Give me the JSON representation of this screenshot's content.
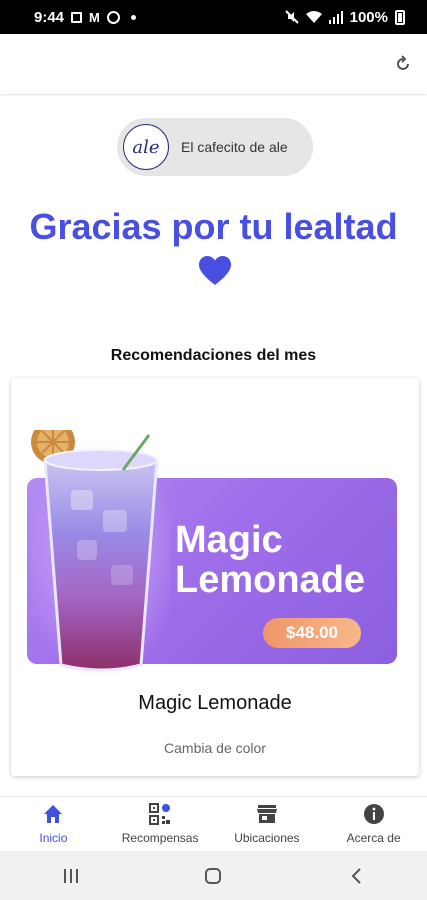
{
  "status_bar": {
    "time": "9:44",
    "battery": "100%"
  },
  "brand": {
    "logo_text": "ale",
    "name": "El cafecito de ale"
  },
  "thanks_title": "Gracias por tu lealtad",
  "section_title": "Recomendaciones del mes",
  "promo": {
    "banner_title": "Magic Lemonade",
    "price": "$48.00",
    "product_name": "Magic Lemonade",
    "description": "Cambia de color"
  },
  "bottom_nav": {
    "items": [
      {
        "label": "Inicio",
        "icon": "home-icon",
        "active": true
      },
      {
        "label": "Recompensas",
        "icon": "qr-icon",
        "active": false
      },
      {
        "label": "Ubicaciones",
        "icon": "store-icon",
        "active": false
      },
      {
        "label": "Acerca de",
        "icon": "info-icon",
        "active": false
      }
    ]
  },
  "colors": {
    "accent": "#4a4fe3",
    "nav_active": "#3f51e0",
    "banner": "#a57aef",
    "price_badge": "#f3a57c"
  }
}
